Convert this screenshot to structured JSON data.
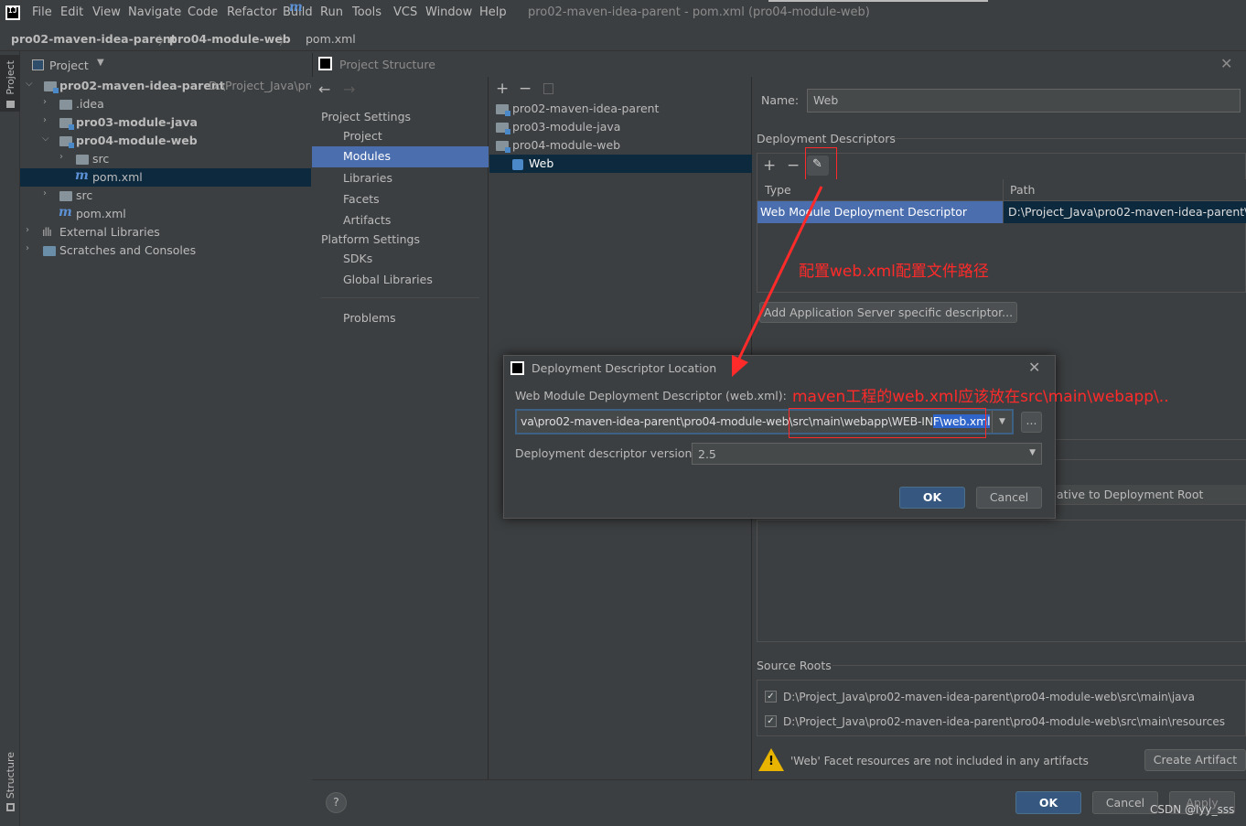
{
  "menubar": {
    "logo": "IJ",
    "items": [
      "File",
      "Edit",
      "View",
      "Navigate",
      "Code",
      "Refactor",
      "Build",
      "Run",
      "Tools",
      "VCS",
      "Window",
      "Help"
    ],
    "window_title": "pro02-maven-idea-parent - pom.xml (pro04-module-web)"
  },
  "breadcrumb": {
    "items": [
      "pro02-maven-idea-parent",
      "pro04-module-web",
      "pom.xml"
    ],
    "file_icon": "m"
  },
  "left_strip": {
    "project_tab": "Project",
    "structure_tab": "Structure"
  },
  "project_panel": {
    "title": "Project",
    "tree": [
      {
        "label": "pro02-maven-idea-parent",
        "hint": "D:\\Project_Java\\pro",
        "bold": true
      },
      {
        "label": ".idea"
      },
      {
        "label": "pro03-module-java",
        "bold": true
      },
      {
        "label": "pro04-module-web",
        "bold": true
      },
      {
        "label": "src"
      },
      {
        "label": "pom.xml"
      },
      {
        "label": "src"
      },
      {
        "label": "pom.xml"
      },
      {
        "label": "External Libraries"
      },
      {
        "label": "Scratches and Consoles"
      }
    ]
  },
  "project_structure": {
    "title": "Project Structure",
    "nav": {
      "project_settings_header": "Project Settings",
      "project_settings": [
        "Project",
        "Modules",
        "Libraries",
        "Facets",
        "Artifacts"
      ],
      "platform_settings_header": "Platform Settings",
      "platform_settings": [
        "SDKs",
        "Global Libraries"
      ],
      "problems": "Problems",
      "selected": "Modules"
    },
    "modules": [
      "pro02-maven-idea-parent",
      "pro03-module-java",
      "pro04-module-web",
      "Web"
    ],
    "right": {
      "name_label": "Name:",
      "name_value": "Web",
      "deployment_descriptors": "Deployment Descriptors",
      "col_type": "Type",
      "col_path": "Path",
      "row_type": "Web Module Deployment Descriptor",
      "row_path": "D:\\Project_Java\\pro02-maven-idea-parent\\pr",
      "add_server_btn": "Add Application Server specific descriptor...",
      "relative_label": "ative to Deployment Root",
      "source_roots": "Source Roots",
      "source_root_1": "D:\\Project_Java\\pro02-maven-idea-parent\\pro04-module-web\\src\\main\\java",
      "source_root_2": "D:\\Project_Java\\pro02-maven-idea-parent\\pro04-module-web\\src\\main\\resources",
      "warning": "'Web' Facet resources are not included in any artifacts",
      "create_artifact_btn": "Create Artifact"
    },
    "footer": {
      "help": "?",
      "ok": "OK",
      "cancel": "Cancel",
      "apply": "Apply"
    }
  },
  "deploy_dialog": {
    "title": "Deployment Descriptor Location",
    "field_label": "Web Module Deployment Descriptor (web.xml):",
    "path_value_a": "va\\pro02-maven-idea-parent\\pro04-module-web\\",
    "path_value_b": "src\\main\\webapp\\WEB-IN",
    "path_value_c": "F\\web.xml",
    "browse": "...",
    "version_label": "Deployment descriptor version",
    "version_value": "2.5",
    "ok": "OK",
    "cancel": "Cancel"
  },
  "annotations": {
    "note1": "配置web.xml配置文件路径",
    "note2": "maven工程的web.xml应该放在src\\main\\webapp\\.."
  },
  "watermark": "CSDN @lyy_sss",
  "colors": {
    "selection": "#4b6eaf",
    "tree_selection": "#0d293e",
    "annotation": "#ff2a2a",
    "primary_button": "#365880"
  }
}
